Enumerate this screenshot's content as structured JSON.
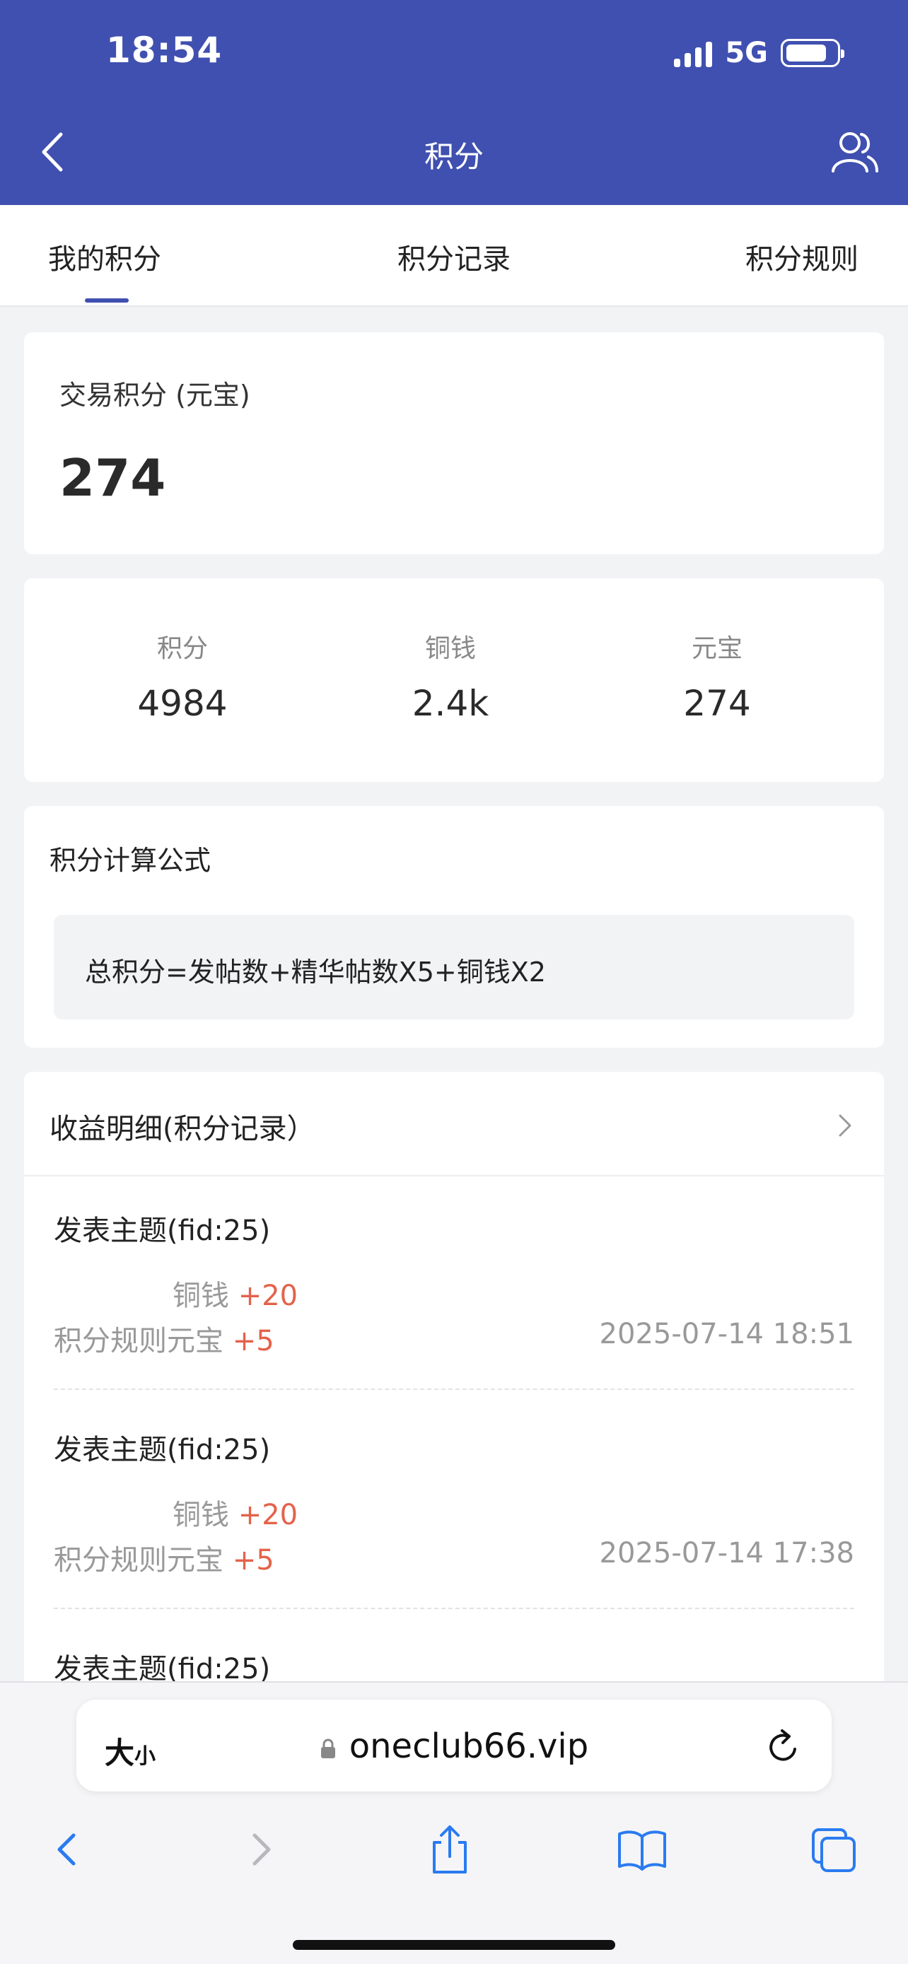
{
  "status_bar": {
    "time": "18:54",
    "network": "5G"
  },
  "nav": {
    "title": "积分"
  },
  "tabs": [
    {
      "label": "我的积分",
      "active": true
    },
    {
      "label": "积分记录",
      "active": false
    },
    {
      "label": "积分规则",
      "active": false
    }
  ],
  "trade_points": {
    "label": "交易积分 (元宝)",
    "value": "274"
  },
  "stats": [
    {
      "label": "积分",
      "value": "4984"
    },
    {
      "label": "铜钱",
      "value": "2.4k"
    },
    {
      "label": "元宝",
      "value": "274"
    }
  ],
  "formula": {
    "title": "积分计算公式",
    "text": "总积分=发帖数+精华帖数X5+铜钱X2"
  },
  "records": {
    "title": "收益明细(积分记录）",
    "items": [
      {
        "title": "发表主题(fid:25)",
        "line1_label": "铜钱",
        "line1_value": "+20",
        "line2_label": "积分规则元宝",
        "line2_value": "+5",
        "time": "2025-07-14 18:51"
      },
      {
        "title": "发表主题(fid:25)",
        "line1_label": "铜钱",
        "line1_value": "+20",
        "line2_label": "积分规则元宝",
        "line2_value": "+5",
        "time": "2025-07-14 17:38"
      },
      {
        "title": "发表主题(fid:25)"
      }
    ]
  },
  "browser": {
    "aa_big": "大",
    "aa_small": "小",
    "url": "oneclub66.vip"
  },
  "colors": {
    "header": "#4050b0",
    "plus": "#e4624a",
    "ios_blue": "#2a7bf0"
  },
  "icons": [
    "back-icon",
    "users-icon",
    "chevron-right-icon",
    "lock-icon",
    "reload-icon",
    "share-icon",
    "bookmarks-icon",
    "tabs-icon"
  ]
}
